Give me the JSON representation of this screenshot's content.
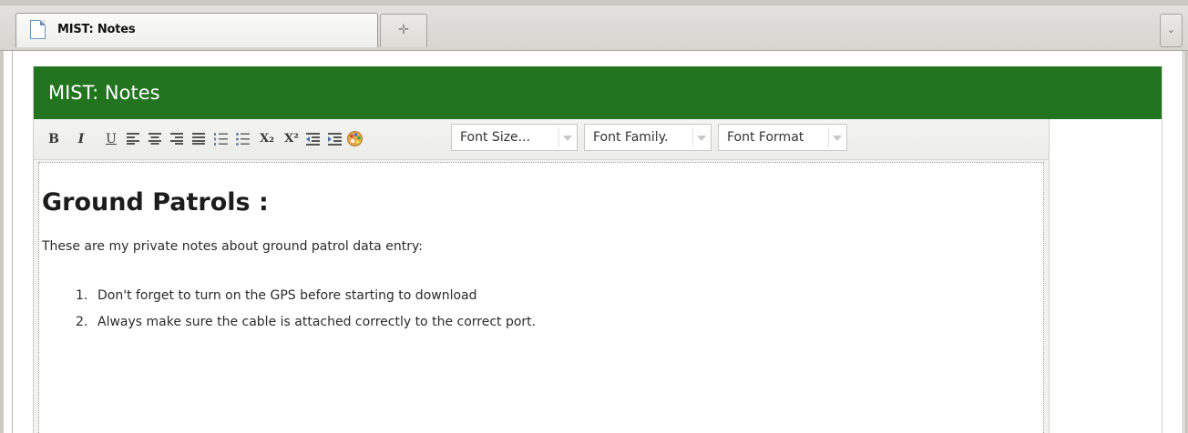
{
  "browser": {
    "tab_title": "MIST: Notes",
    "new_tab_glyph": "✛",
    "list_tabs_glyph": "⌄",
    "icons": {
      "tab": "page-icon",
      "new_tab": "plus-icon",
      "list_tabs": "chevron-down-icon"
    }
  },
  "panel": {
    "title": "MIST: Notes",
    "header_color": "#22741f"
  },
  "toolbar": {
    "bold": "B",
    "italic": "I",
    "underline": "U",
    "subscript": "X₂",
    "superscript": "X²",
    "font_size": "Font Size...",
    "font_family": "Font Family.",
    "font_format": "Font Format",
    "icons": [
      "bold-icon",
      "italic-icon",
      "underline-icon",
      "align-left-icon",
      "align-center-icon",
      "align-right-icon",
      "align-justify-icon",
      "ordered-list-icon",
      "unordered-list-icon",
      "subscript-icon",
      "superscript-icon",
      "outdent-icon",
      "indent-icon",
      "color-palette-icon"
    ]
  },
  "document": {
    "heading": "Ground Patrols :",
    "paragraph": "These are my private notes about ground patrol data entry:",
    "list": [
      {
        "number": "1.",
        "text": "Don't forget to turn on the GPS before starting to download"
      },
      {
        "number": "2.",
        "text": "Always make sure the cable is attached correctly to the correct port."
      }
    ]
  }
}
